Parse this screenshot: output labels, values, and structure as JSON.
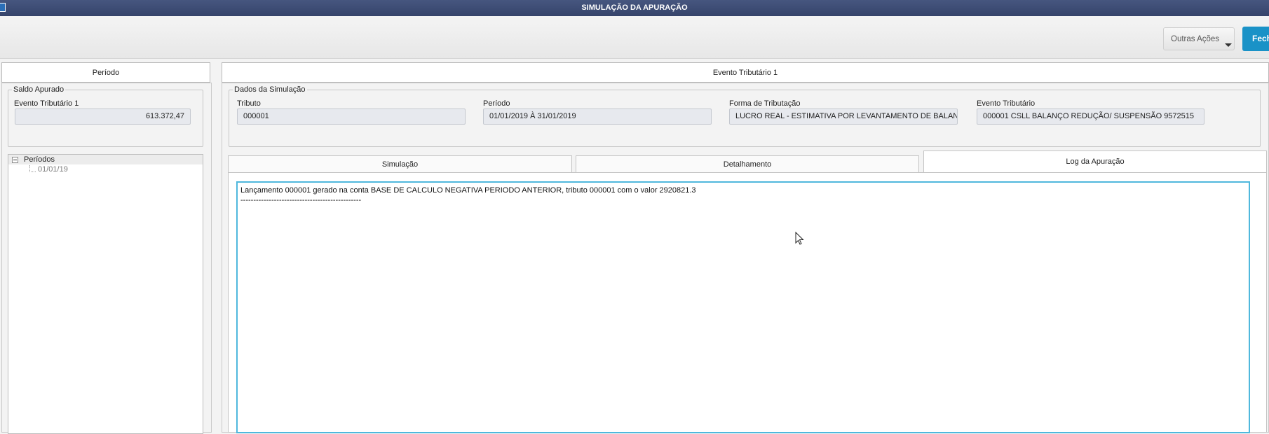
{
  "window": {
    "title": "SIMULAÇÃO DA APURAÇÃO"
  },
  "toolbar": {
    "outras_acoes": "Outras Ações",
    "fechar": "Fech"
  },
  "left": {
    "header": "Período",
    "saldo_group": "Saldo Apurado",
    "evento_label": "Evento Tributário 1",
    "evento_value": "613.372,47",
    "tree": {
      "root": "Períodos",
      "children": [
        "01/01/19"
      ]
    }
  },
  "right": {
    "header": "Evento Tributário 1",
    "dados_group": "Dados da Simulação",
    "fields": [
      {
        "label": "Tributo",
        "value": "000001"
      },
      {
        "label": "Período",
        "value": "01/01/2019 À 31/01/2019"
      },
      {
        "label": "Forma de Tributação",
        "value": "LUCRO REAL - ESTIMATIVA POR LEVANTAMENTO DE BALANÇO"
      },
      {
        "label": "Evento Tributário",
        "value": "000001 CSLL BALANÇO REDUÇÃO/ SUSPENSÃO 9572515"
      }
    ],
    "tabs": [
      "Simulação",
      "Detalhamento",
      "Log da Apuração"
    ],
    "active_tab": "Log da Apuração",
    "log_text": "Lançamento 000001 gerado na conta BASE DE CALCULO NEGATIVA PERIODO ANTERIOR, tributo 000001 com o valor 2920821.3\n-----------------------------------------------"
  },
  "colors": {
    "titlebar": "#3d4b74",
    "accent": "#1a92c7",
    "log_border": "#4fb8dd"
  }
}
